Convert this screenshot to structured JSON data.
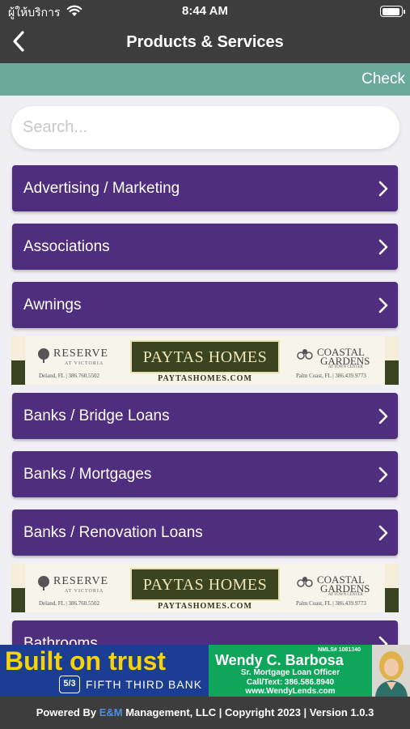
{
  "status_bar": {
    "carrier": "ผู้ให้บริการ",
    "time": "8:44 AM",
    "icons": [
      "wifi-icon",
      "battery-icon"
    ]
  },
  "nav": {
    "title": "Products & Services",
    "back_icon": "chevron-left-icon"
  },
  "check_label": "Check",
  "search": {
    "placeholder": "Search...",
    "value": ""
  },
  "categories": [
    {
      "label": "Advertising / Marketing"
    },
    {
      "label": "Associations"
    },
    {
      "label": "Awnings"
    },
    {
      "label": "Banks / Bridge Loans"
    },
    {
      "label": "Banks / Mortgages"
    },
    {
      "label": "Banks / Renovation Loans"
    },
    {
      "label": "Bathrooms"
    }
  ],
  "ad_strip": {
    "reserve_name": "RESERVE",
    "reserve_the": "THE",
    "reserve_sub": "AT VICTORIA",
    "reserve_location": "Deland, FL | 386.760.5502",
    "paytas_name": "PAYTAS HOMES",
    "paytas_url": "PAYTASHOMES.COM",
    "coastal_name_1": "COASTAL",
    "coastal_name_2": "GARDENS",
    "coastal_sub": "AT TOWN CENTER",
    "coastal_location": "Palm Coast, FL | 386.439.9773"
  },
  "banner": {
    "headline": "Built on trust",
    "bank_mark": "5/3",
    "bank_name": "FIFTH THIRD BANK",
    "nmls": "NMLS# 1081340",
    "person_name": "Wendy C. Barbosa",
    "person_title": "Sr. Mortgage Loan Officer",
    "phone": "Call/Text: 386.586.8940",
    "website": "www.WendyLends.com"
  },
  "colors": {
    "header_bg": "#3d3d3d",
    "check_bar": "#6aa99c",
    "category_bg": "#4f2e7f",
    "page_bg": "#f0eff4",
    "banner_blue": "#1c3d94",
    "banner_green": "#0fa55a",
    "banner_yellow": "#f5d20a"
  },
  "footer": {
    "prefix": "Powered By ",
    "brand": "E&M",
    "suffix": " Management, LLC | Copyright 2023 | Version 1.0.3"
  }
}
